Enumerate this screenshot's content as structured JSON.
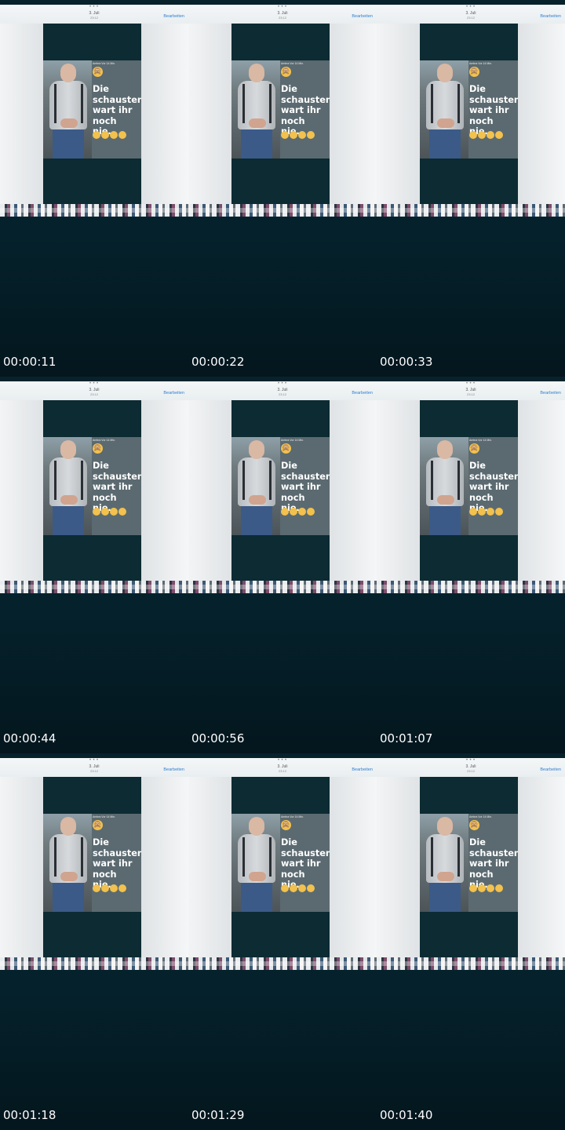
{
  "topbar": {
    "dots": "•••",
    "date": "3. Juli",
    "time": "23:12",
    "edit_label": "Bearbeiten"
  },
  "story": {
    "username": "Ambra",
    "meta": "Vor 14 Min.",
    "caption": "Die schausten wart ihr noch nie…",
    "top_emoji": "🙊",
    "emoji_row": "🤣🤣🤣🤣",
    "emoji_count": 4
  },
  "frames": [
    {
      "timestamp": "00:00:11"
    },
    {
      "timestamp": "00:00:22"
    },
    {
      "timestamp": "00:00:33"
    },
    {
      "timestamp": "00:00:44"
    },
    {
      "timestamp": "00:00:56"
    },
    {
      "timestamp": "00:01:07"
    },
    {
      "timestamp": "00:01:18"
    },
    {
      "timestamp": "00:01:29"
    },
    {
      "timestamp": "00:01:40"
    }
  ]
}
